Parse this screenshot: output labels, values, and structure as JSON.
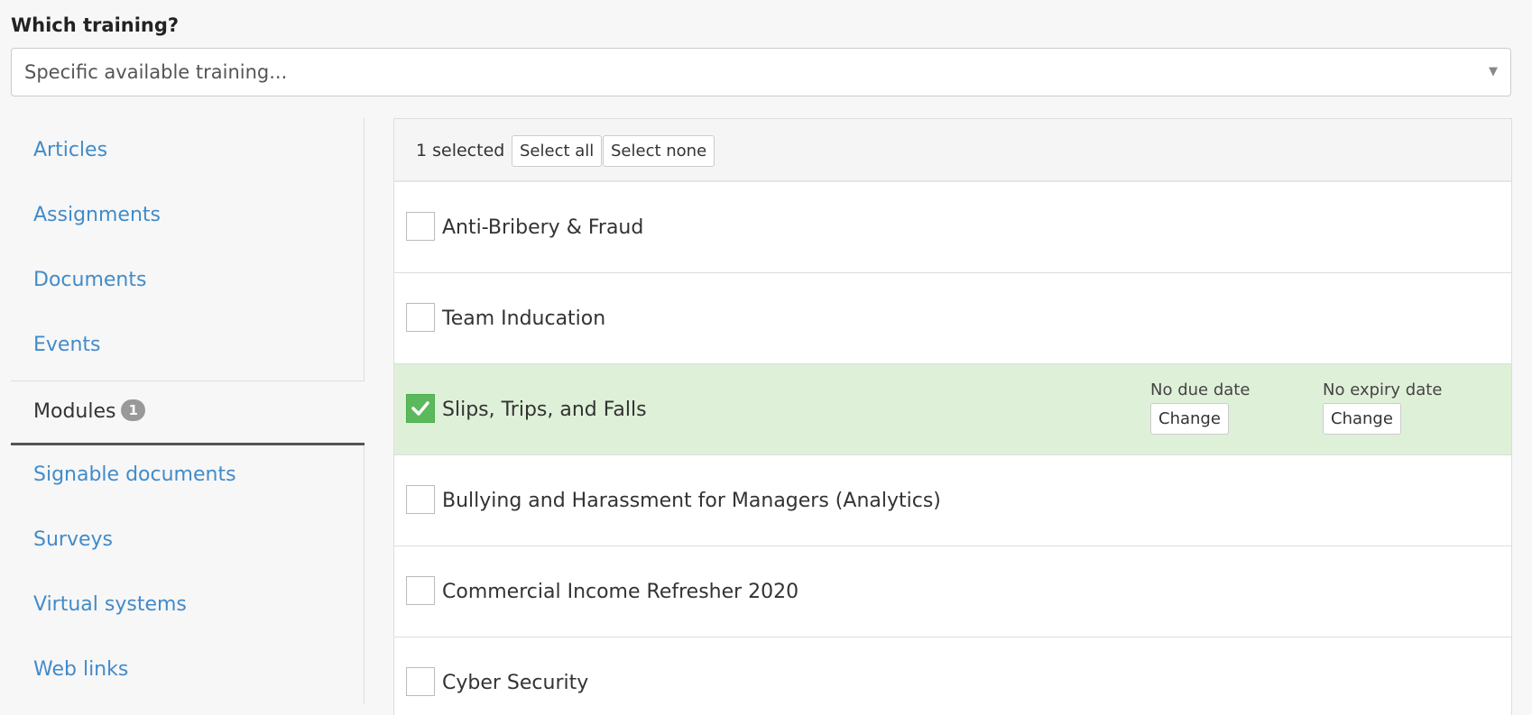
{
  "form": {
    "question": "Which training?",
    "select_value": "Specific available training..."
  },
  "sidebar": {
    "items": [
      {
        "label": "Articles"
      },
      {
        "label": "Assignments"
      },
      {
        "label": "Documents"
      },
      {
        "label": "Events"
      },
      {
        "label": "Modules",
        "badge": "1",
        "active": true
      },
      {
        "label": "Signable documents"
      },
      {
        "label": "Surveys"
      },
      {
        "label": "Virtual systems"
      },
      {
        "label": "Web links"
      }
    ]
  },
  "toolbar": {
    "selected_count": "1 selected",
    "select_all_label": "Select all",
    "select_none_label": "Select none"
  },
  "modules": [
    {
      "title": "Anti-Bribery & Fraud",
      "checked": false
    },
    {
      "title": "Team Inducation",
      "checked": false
    },
    {
      "title": "Slips, Trips, and Falls",
      "checked": true,
      "due_text": "No due date",
      "expiry_text": "No expiry date",
      "change_label": "Change"
    },
    {
      "title": "Bullying and Harassment for Managers (Analytics)",
      "checked": false
    },
    {
      "title": "Commercial Income Refresher 2020",
      "checked": false
    },
    {
      "title": "Cyber Security",
      "checked": false
    }
  ],
  "colors": {
    "link": "#428bca",
    "selected_row": "#dff0d8",
    "checkbox_checked": "#5cb85c",
    "badge": "#999999"
  },
  "icons": {
    "dropdown": "chevron-down-icon",
    "check": "check-icon"
  }
}
